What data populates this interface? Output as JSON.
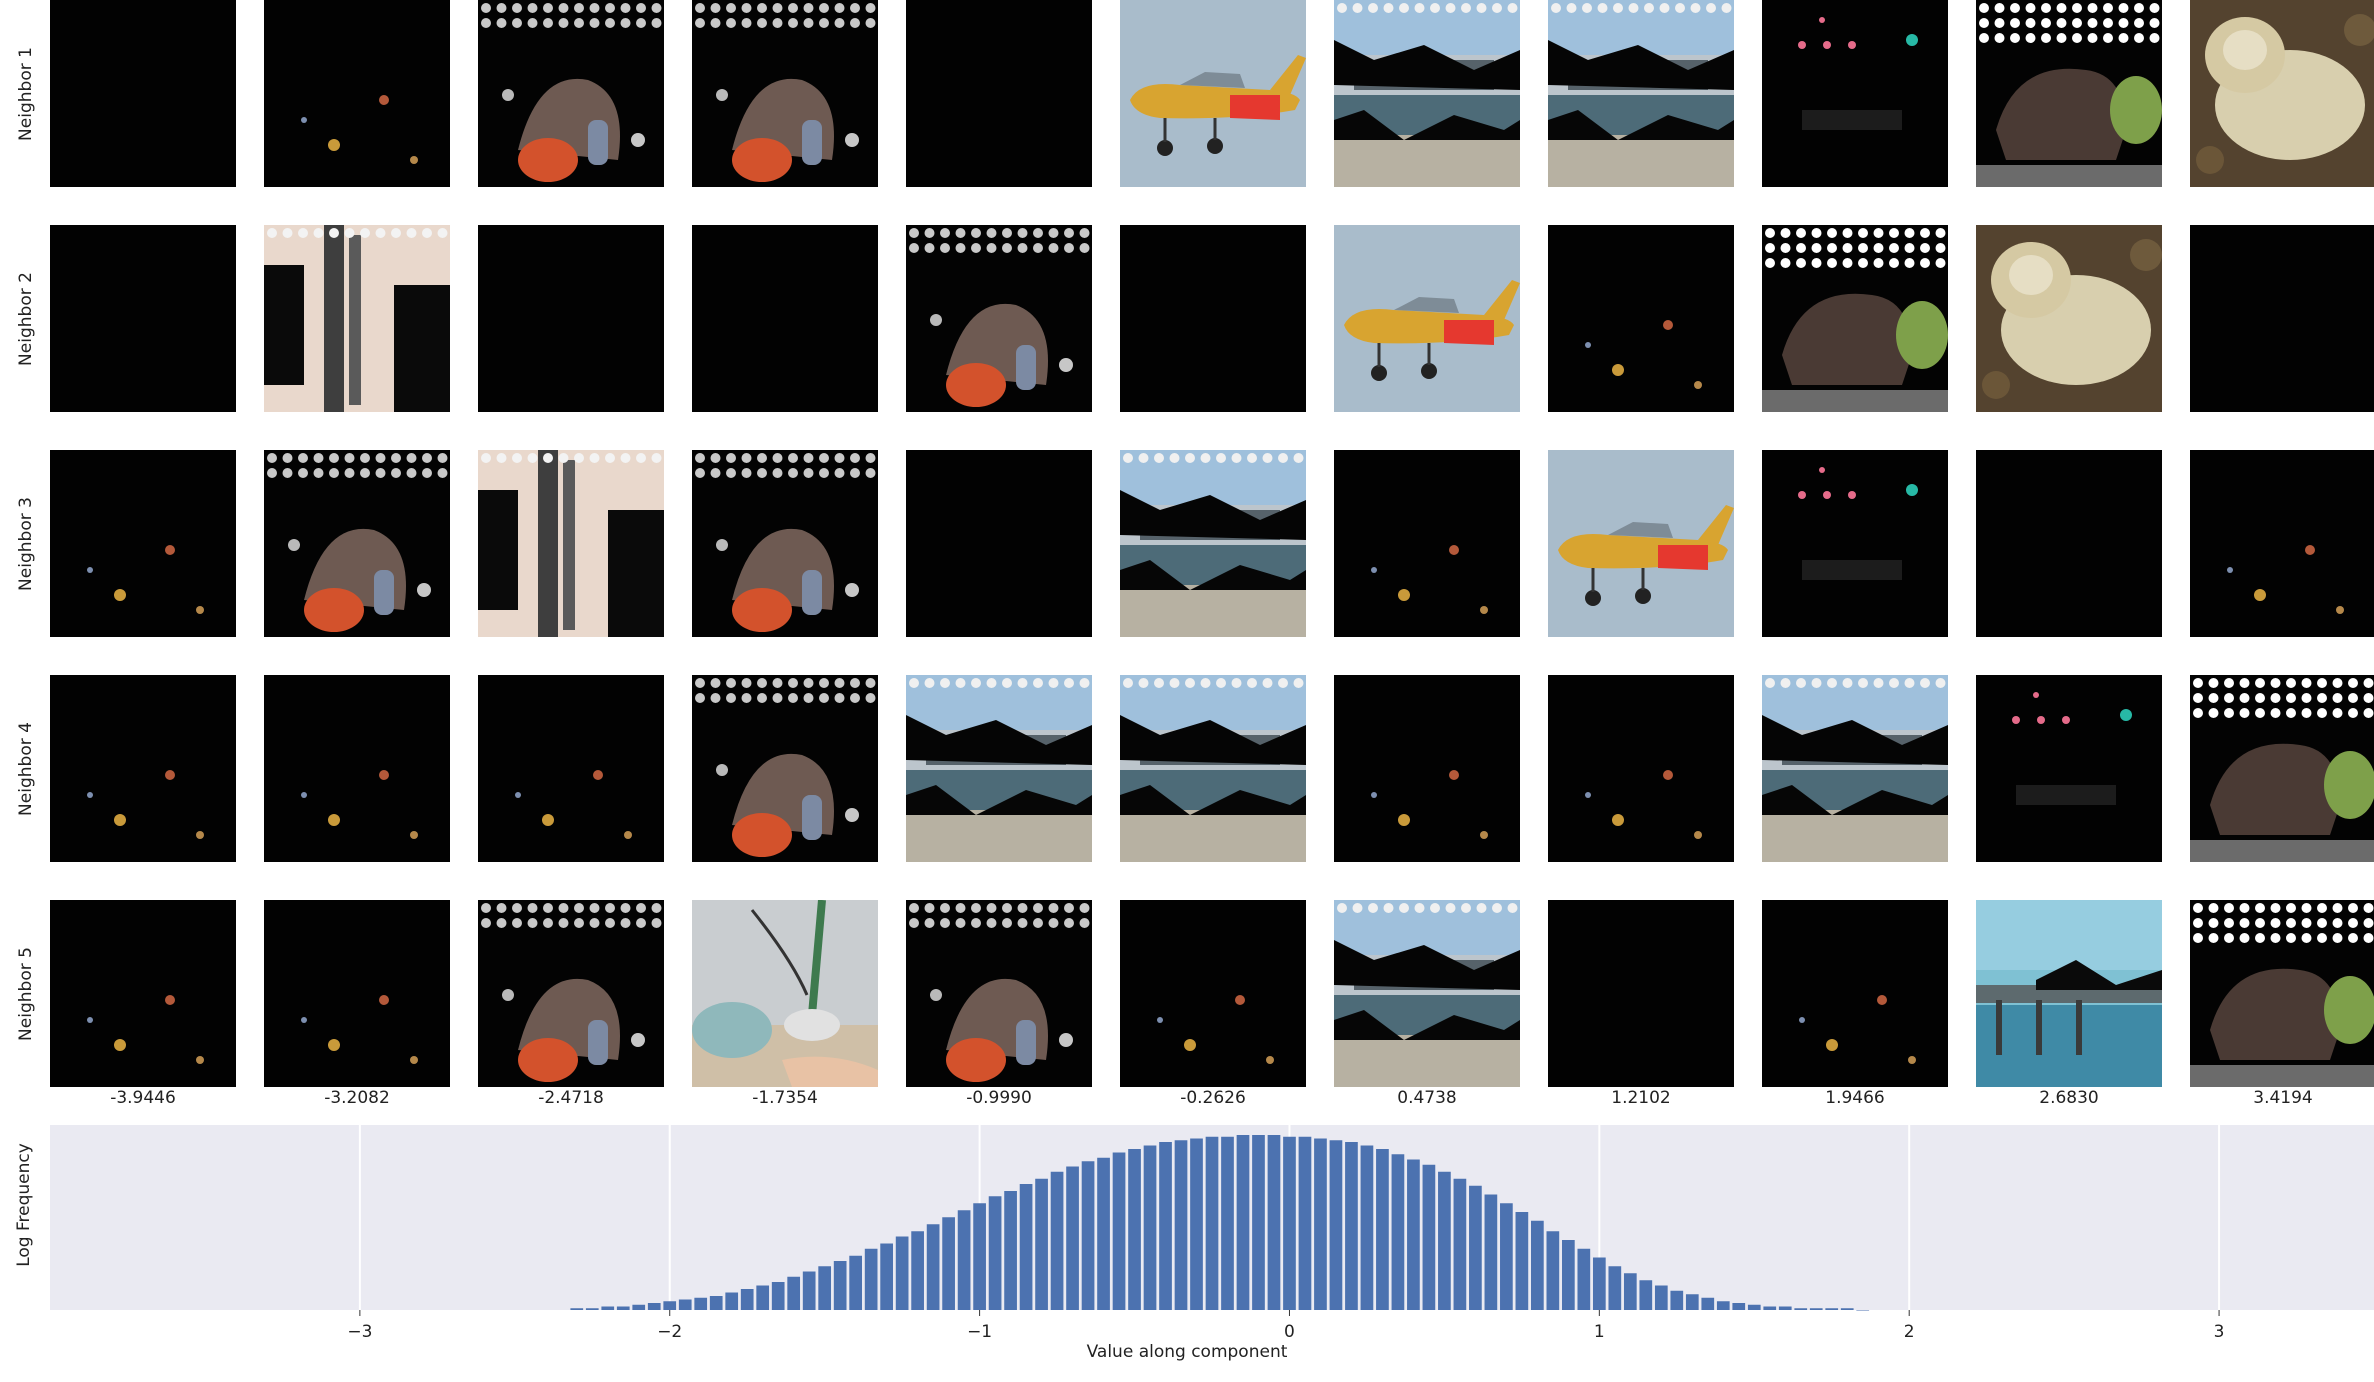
{
  "rows": [
    {
      "label": "Neighbor 1"
    },
    {
      "label": "Neighbor 2"
    },
    {
      "label": "Neighbor 3"
    },
    {
      "label": "Neighbor 4"
    },
    {
      "label": "Neighbor 5"
    }
  ],
  "columns": [
    {
      "value": "-3.9446"
    },
    {
      "value": "-3.2082"
    },
    {
      "value": "-2.4718"
    },
    {
      "value": "-1.7354"
    },
    {
      "value": "-0.9990"
    },
    {
      "value": "-0.2626"
    },
    {
      "value": "0.4738"
    },
    {
      "value": "1.2102"
    },
    {
      "value": "1.9466"
    },
    {
      "value": "2.6830"
    },
    {
      "value": "3.4194"
    }
  ],
  "thumbnails": [
    [
      "dark",
      "dark-speck",
      "toy",
      "toy",
      "dark",
      "airplane",
      "harbor",
      "harbor",
      "dots",
      "horse",
      "mushroom"
    ],
    [
      "dark",
      "curtain",
      "dark",
      "dark",
      "toy",
      "dark",
      "airplane",
      "dark-speck",
      "horse",
      "mushroom",
      "dark"
    ],
    [
      "dark-speck",
      "toy",
      "curtain",
      "toy",
      "dark",
      "harbor",
      "dark-speck",
      "airplane",
      "dots",
      "dark",
      "dark-speck"
    ],
    [
      "dark-speck",
      "dark-speck",
      "dark-speck",
      "toy",
      "harbor",
      "harbor",
      "dark-speck",
      "dark-speck",
      "harbor",
      "dots",
      "horse"
    ],
    [
      "dark-speck",
      "dark-speck",
      "toy",
      "mop",
      "toy",
      "dark-speck",
      "harbor",
      "dark",
      "dark-speck",
      "pier",
      "horse"
    ]
  ],
  "chart_data": {
    "type": "bar",
    "title": "",
    "xlabel": "Value along component",
    "ylabel": "Log Frequency",
    "xlim": [
      -4.0,
      3.5
    ],
    "x_ticks": [
      -3,
      -2,
      -1,
      0,
      1,
      2,
      3
    ],
    "x_tick_labels": [
      "−3",
      "−2",
      "−1",
      "0",
      "1",
      "2",
      "3"
    ],
    "grid": true,
    "bin_centers": [
      -2.3,
      -2.25,
      -2.2,
      -2.15,
      -2.1,
      -2.05,
      -2.0,
      -1.95,
      -1.9,
      -1.85,
      -1.8,
      -1.75,
      -1.7,
      -1.65,
      -1.6,
      -1.55,
      -1.5,
      -1.45,
      -1.4,
      -1.35,
      -1.3,
      -1.25,
      -1.2,
      -1.15,
      -1.1,
      -1.05,
      -1.0,
      -0.95,
      -0.9,
      -0.85,
      -0.8,
      -0.75,
      -0.7,
      -0.65,
      -0.6,
      -0.55,
      -0.5,
      -0.45,
      -0.4,
      -0.35,
      -0.3,
      -0.25,
      -0.2,
      -0.15,
      -0.1,
      -0.05,
      0.0,
      0.05,
      0.1,
      0.15,
      0.2,
      0.25,
      0.3,
      0.35,
      0.4,
      0.45,
      0.5,
      0.55,
      0.6,
      0.65,
      0.7,
      0.75,
      0.8,
      0.85,
      0.9,
      0.95,
      1.0,
      1.05,
      1.1,
      1.15,
      1.2,
      1.25,
      1.3,
      1.35,
      1.4,
      1.45,
      1.5,
      1.55,
      1.6,
      1.65,
      1.7,
      1.75,
      1.8,
      1.85
    ],
    "values": [
      0.01,
      0.01,
      0.02,
      0.02,
      0.03,
      0.04,
      0.05,
      0.06,
      0.07,
      0.08,
      0.1,
      0.12,
      0.14,
      0.16,
      0.19,
      0.22,
      0.25,
      0.28,
      0.31,
      0.35,
      0.38,
      0.42,
      0.45,
      0.49,
      0.53,
      0.57,
      0.61,
      0.65,
      0.68,
      0.72,
      0.75,
      0.79,
      0.82,
      0.85,
      0.87,
      0.9,
      0.92,
      0.94,
      0.96,
      0.97,
      0.98,
      0.99,
      0.99,
      1.0,
      1.0,
      1.0,
      0.99,
      0.99,
      0.98,
      0.97,
      0.96,
      0.94,
      0.92,
      0.89,
      0.86,
      0.83,
      0.79,
      0.75,
      0.71,
      0.66,
      0.61,
      0.56,
      0.51,
      0.45,
      0.4,
      0.35,
      0.3,
      0.25,
      0.21,
      0.17,
      0.14,
      0.11,
      0.09,
      0.07,
      0.05,
      0.04,
      0.03,
      0.02,
      0.02,
      0.01,
      0.01,
      0.01,
      0.01,
      0.0
    ],
    "colors": {
      "bar": "#4c72b0",
      "background": "#eaeaf2",
      "grid": "#ffffff"
    }
  }
}
